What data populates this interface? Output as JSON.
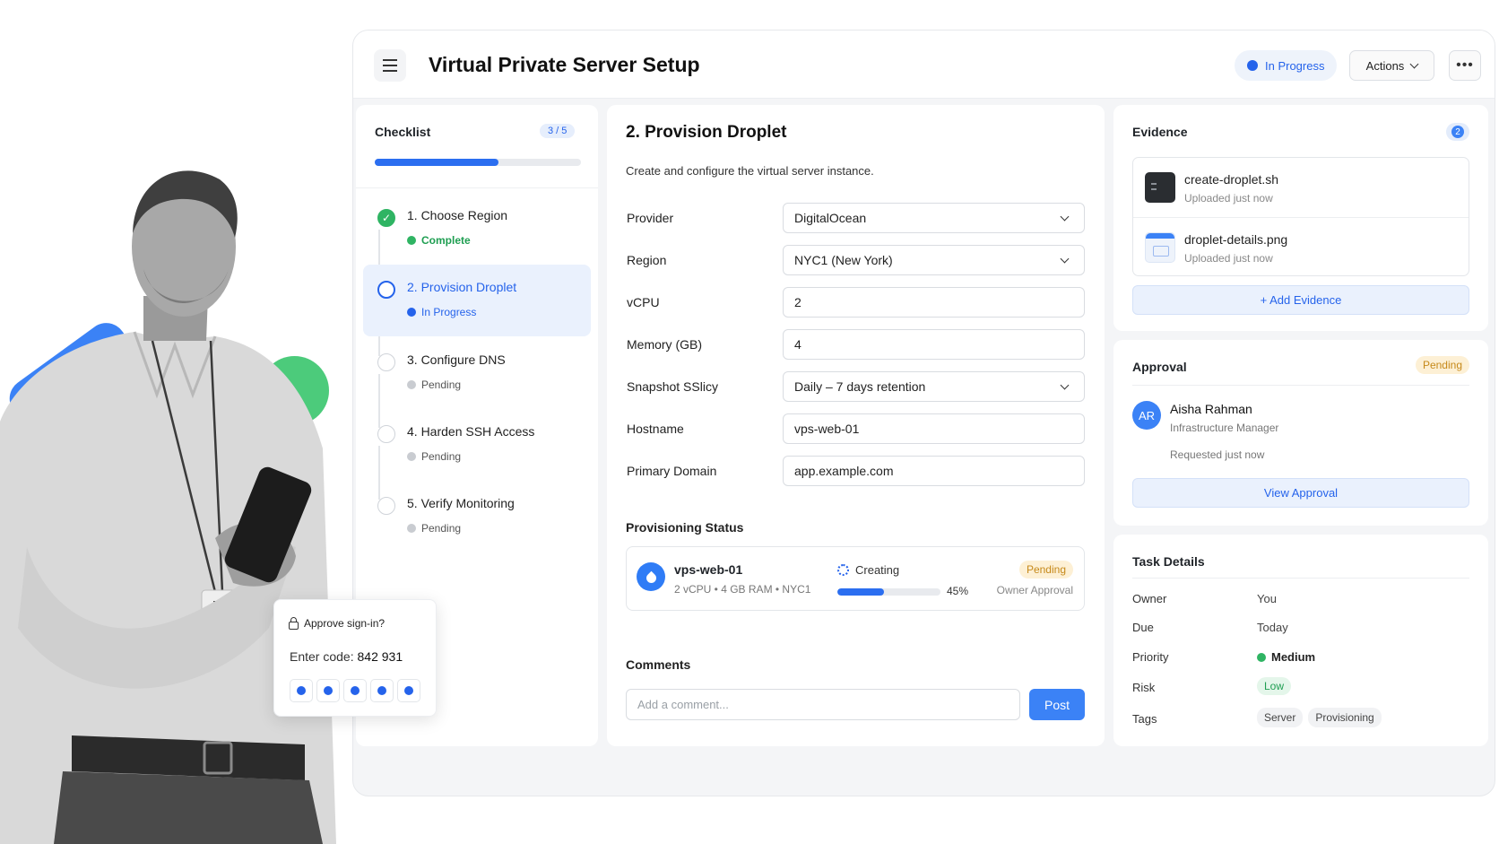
{
  "header": {
    "title": "Virtual Private Server Setup",
    "status": "In Progress",
    "actions_label": "Actions",
    "more_label": "•••"
  },
  "checklist": {
    "title": "Checklist",
    "count": "3 / 5",
    "progress_fraction": 0.6,
    "steps": [
      {
        "name": "1. Choose Region",
        "status": "Complete"
      },
      {
        "name": "2. Provision Droplet",
        "status": "In Progress"
      },
      {
        "name": "3. Configure DNS",
        "status": "Pending"
      },
      {
        "name": "4. Harden SSH Access",
        "status": "Pending"
      },
      {
        "name": "5. Verify Monitoring",
        "status": "Pending"
      }
    ]
  },
  "main": {
    "title": "2. Provision Droplet",
    "description": "Create and configure the virtual server instance.",
    "fields": [
      {
        "label": "Provider",
        "value": "DigitalOcean"
      },
      {
        "label": "Region",
        "value": "NYC1 (New York)"
      },
      {
        "label": "vCPU",
        "value": "2"
      },
      {
        "label": "Memory (GB)",
        "value": "4"
      },
      {
        "label": "Snapshot SSlicy",
        "value": "Daily – 7 days retention"
      },
      {
        "label": "Hostname",
        "value": "vps-web-01"
      },
      {
        "label": "Primary Domain",
        "value": "app.example.com"
      }
    ],
    "provisioning": {
      "heading": "Provisioning Status",
      "name": "vps-web-01",
      "spec": "2 vCPU • 4 GB RAM • NYC1",
      "state": "Creating",
      "percent_label": "45%",
      "progress_fraction": 0.45,
      "badge": "Pending",
      "note": "Owner Approval"
    },
    "comments": {
      "heading": "Comments",
      "placeholder": "Add a comment...",
      "post_label": "Post"
    }
  },
  "evidence": {
    "title": "Evidence",
    "count": "2",
    "files": [
      {
        "name": "create-droplet.sh",
        "meta": "Uploaded just now"
      },
      {
        "name": "droplet-details.png",
        "meta": "Uploaded just now"
      }
    ],
    "add_label": "+ Add Evidence"
  },
  "approval": {
    "title": "Approval",
    "badge": "Pending",
    "initials": "AR",
    "name": "Aisha Rahman",
    "role": "Infrastructure Manager",
    "requested": "Requested just now",
    "view_label": "View Approval"
  },
  "task_details": {
    "title": "Task Details",
    "labels": {
      "owner": "Owner",
      "due": "Due",
      "priority": "Priority",
      "risk": "Risk",
      "tags": "Tags"
    },
    "owner": "You",
    "due": "Today",
    "priority": "Medium",
    "risk": "Low",
    "tags": [
      "Server",
      "Provisioning"
    ]
  },
  "signin_popup": {
    "title": "Approve sign-in?",
    "code_prefix": "Enter code:",
    "code": "842 931"
  },
  "colors": {
    "accent": "#2563eb",
    "success": "#2fb463",
    "warning": "#c6891a",
    "deco_blue": "#3b82f6",
    "deco_green": "#4ccb7b"
  }
}
